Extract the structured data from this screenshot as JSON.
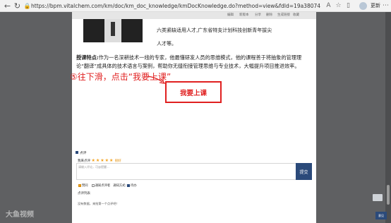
{
  "browser": {
    "url": "https://bpm.vitalchem.com/km/doc/km_doc_knowledge/kmDocKnowledge.do?method=view&fdId=19a3807458f5848ef6965404019b80b9&s_cs...",
    "update_label": "更新"
  },
  "doc_tabs": [
    "编辑",
    "新版本",
    "分享",
    "删除",
    "生成链接",
    "收藏"
  ],
  "profile": {
    "line1": "六类紧缺适用人才,广东省特支计划科技创新青年拔尖",
    "line2": "人才等。"
  },
  "feature": {
    "label": "授课特点:",
    "text": "作为一名深耕技术一线的专家，他最懂研发人员的思维模式，他的课程善于将抽象的管理理论“翻译”成具体的技术语言与案例，帮助你无缝衔接管理思维与专业技术，大幅提升项目推进效率。"
  },
  "annotation": {
    "text": "⑤往下滑，点击“我要上课”",
    "color": "#e02020"
  },
  "enroll_button": {
    "label": "我要上课"
  },
  "comments": {
    "header": "点评",
    "rate_label": "我来点评",
    "stars": "★★★★★",
    "rate_link": "很好",
    "placeholder": "请输入评论，可@提醒...",
    "submit_label": "提交",
    "options": [
      "赞同",
      "通知点评者",
      "通知方式:",
      "待办"
    ],
    "section_title": "点评列表",
    "empty_text": "没有数据，来抢第一个点评吧！",
    "float_button": "意见"
  },
  "watermark": "大鱼视频",
  "colors": {
    "accent": "#e02020",
    "brand": "#2b4a7a",
    "star": "#f3a11b"
  }
}
